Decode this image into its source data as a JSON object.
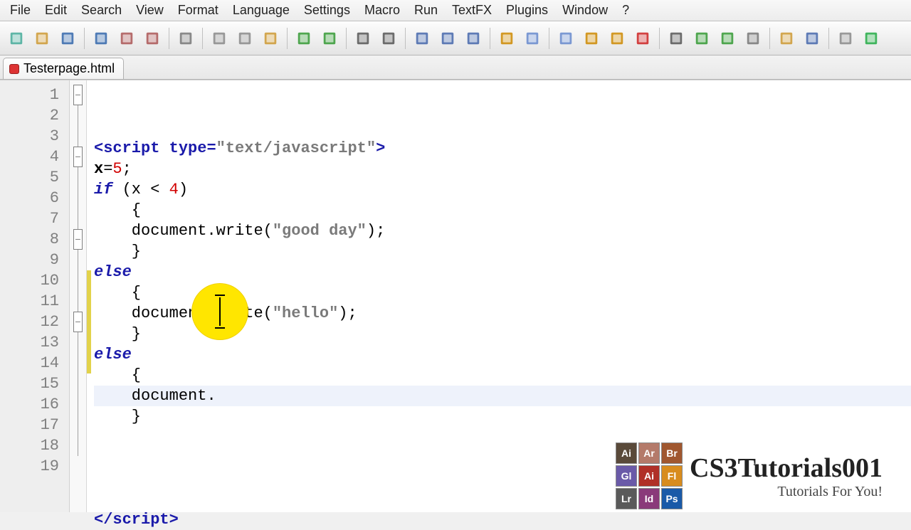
{
  "menubar": [
    "File",
    "Edit",
    "Search",
    "View",
    "Format",
    "Language",
    "Settings",
    "Macro",
    "Run",
    "TextFX",
    "Plugins",
    "Window",
    "?"
  ],
  "tab": {
    "filename": "Testerpage.html"
  },
  "code": {
    "num_lines": 19,
    "lines": [
      {
        "n": 1,
        "fold": "box",
        "chg": false,
        "seg": [
          [
            "tk-tag",
            "<script "
          ],
          [
            "tk-attr",
            "type"
          ],
          [
            "tk-tag",
            "="
          ],
          [
            "tk-str",
            "\"text/javascript\""
          ],
          [
            "tk-tag",
            ">"
          ]
        ]
      },
      {
        "n": 2,
        "fold": "line",
        "chg": false,
        "seg": [
          [
            "tk-var",
            "x"
          ],
          [
            "tk-punct",
            "="
          ],
          [
            "tk-num",
            "5"
          ],
          [
            "tk-punct",
            ";"
          ]
        ]
      },
      {
        "n": 3,
        "fold": "line",
        "chg": false,
        "seg": [
          [
            "tk-kw",
            "if"
          ],
          [
            "tk-punct",
            " (x < "
          ],
          [
            "tk-num",
            "4"
          ],
          [
            "tk-punct",
            ")"
          ]
        ]
      },
      {
        "n": 4,
        "fold": "box",
        "chg": false,
        "seg": [
          [
            "tk-punct",
            "    {"
          ]
        ]
      },
      {
        "n": 5,
        "fold": "line",
        "chg": false,
        "seg": [
          [
            "tk-fn",
            "    document"
          ],
          [
            "tk-punct",
            "."
          ],
          [
            "tk-fn",
            "write"
          ],
          [
            "tk-punct",
            "("
          ],
          [
            "tk-str",
            "\"good day\""
          ],
          [
            "tk-punct",
            ");"
          ]
        ]
      },
      {
        "n": 6,
        "fold": "line",
        "chg": false,
        "seg": [
          [
            "tk-punct",
            "    }"
          ]
        ]
      },
      {
        "n": 7,
        "fold": "line",
        "chg": false,
        "seg": [
          [
            "tk-kw",
            "else"
          ]
        ]
      },
      {
        "n": 8,
        "fold": "box",
        "chg": false,
        "seg": [
          [
            "tk-punct",
            "    {"
          ]
        ]
      },
      {
        "n": 9,
        "fold": "line",
        "chg": false,
        "seg": [
          [
            "tk-fn",
            "    document"
          ],
          [
            "tk-punct",
            "."
          ],
          [
            "tk-fn",
            "write"
          ],
          [
            "tk-punct",
            "("
          ],
          [
            "tk-str",
            "\"hello\""
          ],
          [
            "tk-punct",
            ");"
          ]
        ]
      },
      {
        "n": 10,
        "fold": "line",
        "chg": true,
        "seg": [
          [
            "tk-punct",
            "    }"
          ]
        ]
      },
      {
        "n": 11,
        "fold": "line",
        "chg": true,
        "seg": [
          [
            "tk-kw",
            "else"
          ]
        ]
      },
      {
        "n": 12,
        "fold": "box",
        "chg": true,
        "seg": [
          [
            "tk-punct",
            "    {"
          ]
        ]
      },
      {
        "n": 13,
        "fold": "line",
        "chg": true,
        "hl": true,
        "seg": [
          [
            "tk-fn",
            "    document"
          ],
          [
            "tk-punct",
            "."
          ]
        ]
      },
      {
        "n": 14,
        "fold": "line",
        "chg": true,
        "seg": [
          [
            "tk-punct",
            "    }"
          ]
        ]
      },
      {
        "n": 15,
        "fold": "line",
        "chg": false,
        "seg": []
      },
      {
        "n": 16,
        "fold": "line",
        "chg": false,
        "seg": []
      },
      {
        "n": 17,
        "fold": "line",
        "chg": false,
        "seg": []
      },
      {
        "n": 18,
        "fold": "line",
        "chg": false,
        "seg": []
      },
      {
        "n": 19,
        "fold": "",
        "chg": false,
        "seg": [
          [
            "tk-tag",
            "</"
          ],
          [
            "tk-tag",
            "script"
          ],
          [
            "tk-tag",
            ">"
          ]
        ]
      }
    ]
  },
  "watermark": {
    "title": "CS3Tutorials001",
    "subtitle": "Tutorials For You!",
    "icons": [
      {
        "label": "Ai",
        "bg": "#5a4a3a"
      },
      {
        "label": "Ar",
        "bg": "#b47a6a"
      },
      {
        "label": "Br",
        "bg": "#a0572f"
      },
      {
        "label": "Gl",
        "bg": "#6a5aa8"
      },
      {
        "label": "Ai",
        "bg": "#b03028"
      },
      {
        "label": "Fl",
        "bg": "#d88c1e"
      },
      {
        "label": "Lr",
        "bg": "#5a5a5a"
      },
      {
        "label": "Id",
        "bg": "#8a3a7a"
      },
      {
        "label": "Ps",
        "bg": "#1a5aa8"
      }
    ]
  },
  "toolbar_icons": [
    "new",
    "open",
    "save",
    "saveall",
    "close",
    "closeall",
    "print",
    "cut",
    "copy",
    "paste",
    "undo",
    "redo",
    "find",
    "replace",
    "zoom-in",
    "zoom-out",
    "sync",
    "wrap",
    "show-all",
    "indent",
    "guide",
    "fold",
    "record",
    "stop",
    "play",
    "playfast",
    "save-macro",
    "folder",
    "browser",
    "doc",
    "check"
  ]
}
